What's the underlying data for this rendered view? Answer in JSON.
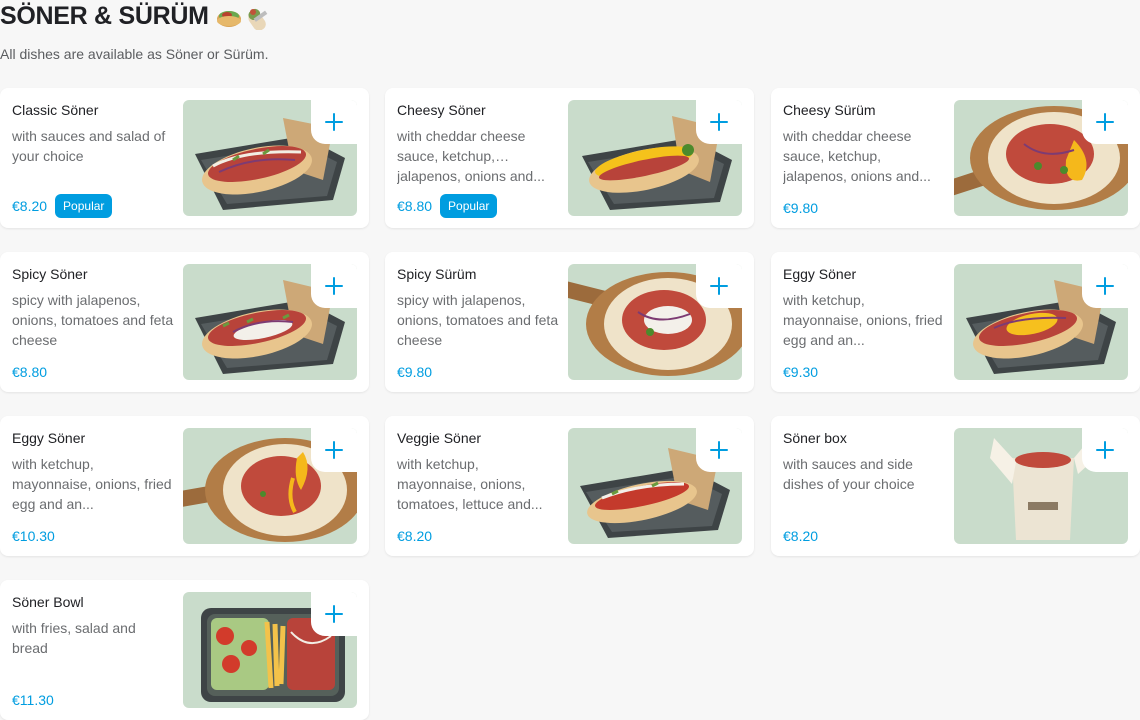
{
  "header": {
    "title": "SÖNER & SÜRÜM",
    "title_icons": [
      "flatbread-sandwich-icon",
      "burrito-icon"
    ],
    "subtitle": "All dishes are available as Söner or Sürüm."
  },
  "colors": {
    "accent": "#009de0",
    "text": "#202125",
    "muted": "#6b6d70",
    "page_background": "#f7f7f7",
    "image_background": "#c9dccb"
  },
  "items": [
    {
      "name": "Classic Söner",
      "description": "with sauces and salad of your choice",
      "price": "€8.20",
      "badge": "Popular",
      "image": "flatbread-tray-photo"
    },
    {
      "name": "Cheesy Söner",
      "description": "with cheddar cheese sauce, ketchup, jalapenos, onions and...",
      "price": "€8.80",
      "badge": "Popular",
      "image": "flatbread-tray-photo"
    },
    {
      "name": "Cheesy Sürüm",
      "description": "with cheddar cheese sauce, ketchup, jalapenos, onions and...",
      "price": "€9.80",
      "badge": "",
      "image": "wrap-board-photo"
    },
    {
      "name": "Spicy Söner",
      "description": "spicy with jalapenos, onions, tomatoes and feta cheese",
      "price": "€8.80",
      "badge": "",
      "image": "flatbread-tray-photo"
    },
    {
      "name": "Spicy Sürüm",
      "description": "spicy with jalapenos, onions, tomatoes and feta cheese",
      "price": "€9.80",
      "badge": "",
      "image": "wrap-board-photo"
    },
    {
      "name": "Eggy Söner",
      "description": "with ketchup, mayonnaise, onions, fried egg and an...",
      "price": "€9.30",
      "badge": "",
      "image": "flatbread-tray-photo"
    },
    {
      "name": "Eggy Söner",
      "description": "with ketchup, mayonnaise, onions, fried egg and an...",
      "price": "€10.30",
      "badge": "",
      "image": "wrap-board-photo"
    },
    {
      "name": "Veggie Söner",
      "description": "with ketchup, mayonnaise, onions, tomatoes, lettuce and...",
      "price": "€8.20",
      "badge": "",
      "image": "flatbread-tray-photo"
    },
    {
      "name": "Söner box",
      "description": "with sauces and side dishes of your choice",
      "price": "€8.20",
      "badge": "",
      "image": "takeaway-box-photo"
    },
    {
      "name": "Söner Bowl",
      "description": "with fries, salad and bread",
      "price": "€11.30",
      "badge": "",
      "image": "bowl-tray-photo"
    }
  ],
  "add_button_icon": "plus-icon"
}
